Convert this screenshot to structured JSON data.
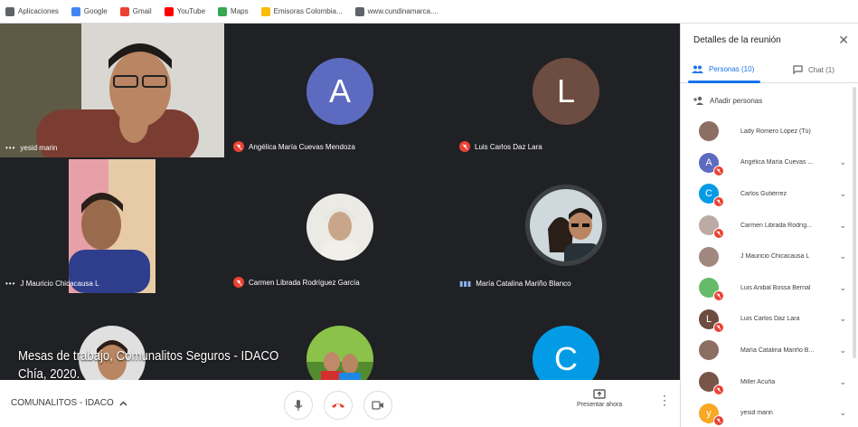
{
  "bookmarks": [
    {
      "label": "Aplicaciones",
      "color": "#5f6368"
    },
    {
      "label": "Google",
      "color": "#4285f4"
    },
    {
      "label": "Gmail",
      "color": "#ea4335"
    },
    {
      "label": "YouTube",
      "color": "#ff0000"
    },
    {
      "label": "Maps",
      "color": "#34a853"
    },
    {
      "label": "Emisoras Colombia...",
      "color": "#fbbc04"
    },
    {
      "label": "www.cundinamarca....",
      "color": "#5f6368"
    }
  ],
  "tiles": [
    {
      "name": "yesid marin",
      "type": "video",
      "status": "active"
    },
    {
      "name": "Angélica María Cuevas Mendoza",
      "type": "letter",
      "letter": "A",
      "color": "#5c6bc0",
      "status": "muted"
    },
    {
      "name": "Luis Carlos Daz Lara",
      "type": "letter",
      "letter": "L",
      "color": "#6d4c41",
      "status": "muted"
    },
    {
      "name": "J Mauricio Chicacausa L",
      "type": "video",
      "status": "active"
    },
    {
      "name": "Carmen Librada Rodríguez García",
      "type": "photo",
      "status": "muted"
    },
    {
      "name": "María Catalina Mariño Blanco",
      "type": "photo",
      "status": "speaking"
    },
    {
      "name": "",
      "type": "photo",
      "status": "none"
    },
    {
      "name": "",
      "type": "photo",
      "status": "none"
    },
    {
      "name": "",
      "type": "letter",
      "letter": "C",
      "color": "#039be5",
      "status": "none"
    }
  ],
  "caption": {
    "line1": "Mesas de trabajo, Comunalitos Seguros - IDACO",
    "line2": "Chía, 2020."
  },
  "bottombar": {
    "meeting_code": "COMUNALITOS - IDACO",
    "present_label": "Presentar ahora"
  },
  "panel": {
    "title": "Detalles de la reunión",
    "tab_people": "Personas (10)",
    "tab_chat": "Chat (1)",
    "add_people": "Añadir personas",
    "participants": [
      {
        "name": "Lady Romero López (Tú)",
        "avatar": "photo",
        "color": "#8d6e63",
        "muted": false
      },
      {
        "name": "Angélica María Cuevas ...",
        "avatar": "letter",
        "letter": "A",
        "color": "#5c6bc0",
        "muted": true
      },
      {
        "name": "Carlos Gutiérrez",
        "avatar": "letter",
        "letter": "C",
        "color": "#039be5",
        "muted": true
      },
      {
        "name": "Carmen Librada Rodríg...",
        "avatar": "photo",
        "color": "#bcaaa4",
        "muted": true
      },
      {
        "name": "J Mauricio Chicacausa L",
        "avatar": "photo",
        "color": "#a1887f",
        "muted": false
      },
      {
        "name": "Luis Anibal Bossa Bernal",
        "avatar": "photo",
        "color": "#66bb6a",
        "muted": true
      },
      {
        "name": "Luis Carlos Daz Lara",
        "avatar": "letter",
        "letter": "L",
        "color": "#6d4c41",
        "muted": true
      },
      {
        "name": "María Catalina Mariño B...",
        "avatar": "photo",
        "color": "#8d6e63",
        "muted": false
      },
      {
        "name": "Miller Acuña",
        "avatar": "photo",
        "color": "#795548",
        "muted": true
      },
      {
        "name": "yesid marin",
        "avatar": "letter",
        "letter": "y",
        "color": "#f9a825",
        "muted": true
      }
    ]
  }
}
